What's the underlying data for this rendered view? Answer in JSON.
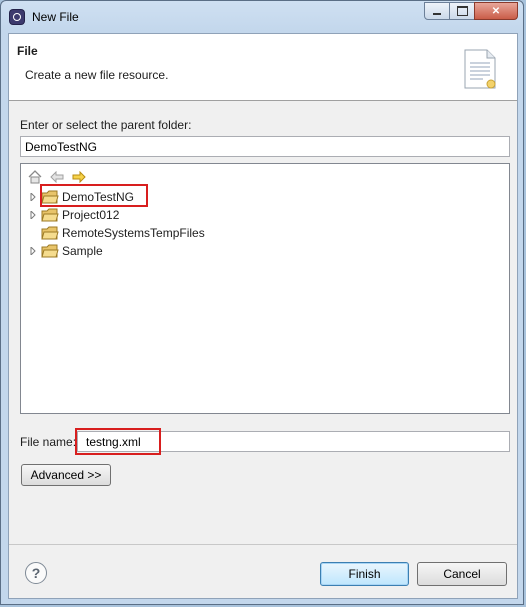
{
  "window": {
    "title": "New File"
  },
  "banner": {
    "title": "File",
    "description": "Create a new file resource."
  },
  "parent_folder": {
    "label": "Enter or select the parent folder:",
    "value": "DemoTestNG"
  },
  "tree": {
    "items": [
      {
        "label": "DemoTestNG",
        "expandable": true
      },
      {
        "label": "Project012",
        "expandable": true
      },
      {
        "label": "RemoteSystemsTempFiles",
        "expandable": false
      },
      {
        "label": "Sample",
        "expandable": true
      }
    ]
  },
  "file_name": {
    "label": "File name:",
    "value": "testng.xml"
  },
  "buttons": {
    "advanced": "Advanced >>",
    "finish": "Finish",
    "cancel": "Cancel",
    "help": "?"
  },
  "colors": {
    "highlight": "#d81e1e",
    "folder": "#e8c46a",
    "window_chrome": "#c3d7ec"
  }
}
